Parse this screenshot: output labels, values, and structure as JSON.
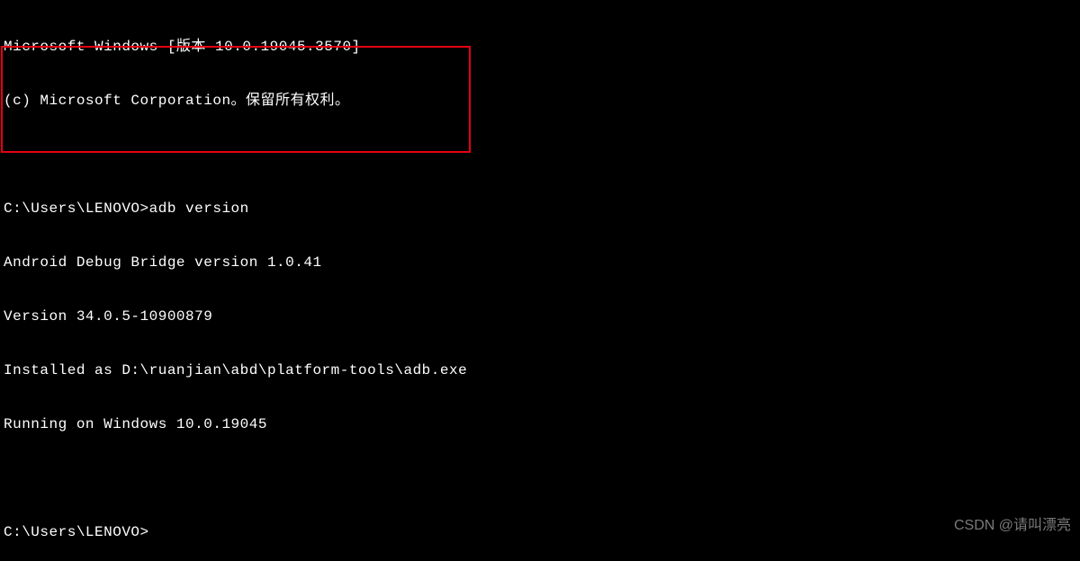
{
  "header": {
    "line1": "Microsoft Windows [版本 10.0.19045.3570]",
    "line2": "(c) Microsoft Corporation。保留所有权利。"
  },
  "session": {
    "prompt1": "C:\\Users\\LENOVO>",
    "command1": "adb version",
    "output": {
      "line1": "Android Debug Bridge version 1.0.41",
      "line2": "Version 34.0.5-10900879",
      "line3": "Installed as D:\\ruanjian\\abd\\platform-tools\\adb.exe",
      "line4": "Running on Windows 10.0.19045"
    },
    "prompt2": "C:\\Users\\LENOVO>"
  },
  "watermark": "CSDN @请叫漂亮",
  "colors": {
    "background": "#000000",
    "text": "#ffffff",
    "highlight_border": "#e60012",
    "watermark": "#7a7a7a"
  }
}
